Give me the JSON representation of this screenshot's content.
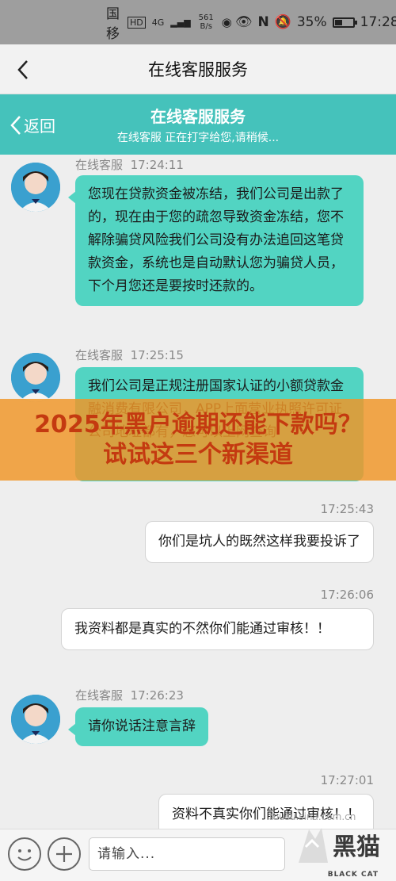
{
  "statusbar": {
    "carrier": "中国移动",
    "hd": "HD",
    "network": "4G",
    "speed_value": "561",
    "speed_unit": "B/s",
    "battery": "35%",
    "time": "17:28"
  },
  "navbar": {
    "title": "在线客服服务"
  },
  "chat_header": {
    "back_label": "返回",
    "title": "在线客服服务",
    "subtitle": "在线客服 正在打字给您,请稍候..."
  },
  "messages": [
    {
      "side": "in",
      "sender": "在线客服",
      "time": "17:24:11",
      "text": "您现在贷款资金被冻结，我们公司是出款了的，现在由于您的疏忽导致资金冻结，您不解除骗贷风险我们公司没有办法追回这笔贷款资金，系统也是自动默认您为骗贷人员，下个月您还是要按时还款的。"
    },
    {
      "side": "in",
      "sender": "在线客服",
      "time": "17:25:15",
      "text": "我们公司是正规注册国家认证的小额贷款金融消费有限公司，APP上面营业执照许可证公司地址都有，您可以上网查询"
    },
    {
      "side": "out",
      "time": "17:25:43",
      "text": "你们是坑人的既然这样我要投诉了"
    },
    {
      "side": "out",
      "time": "17:26:06",
      "text": "我资料都是真实的不然你们能通过审核！！"
    },
    {
      "side": "in",
      "sender": "在线客服",
      "time": "17:26:23",
      "text": "请你说话注意言辞"
    },
    {
      "side": "out",
      "time": "17:27:01",
      "text": "资料不真实你们能通过审核！！"
    }
  ],
  "banner": {
    "text": "2025年黑户逾期还能下款吗？试试这三个新渠道"
  },
  "input": {
    "placeholder": "请输入..."
  },
  "watermark": {
    "logo_text": "黑猫",
    "sub_text": "BLACK CAT",
    "url": "tousu.sina.com.cn"
  },
  "colors": {
    "accent": "#45c2bb",
    "bubble_in": "#52d4c2",
    "banner": "#f0962c"
  }
}
